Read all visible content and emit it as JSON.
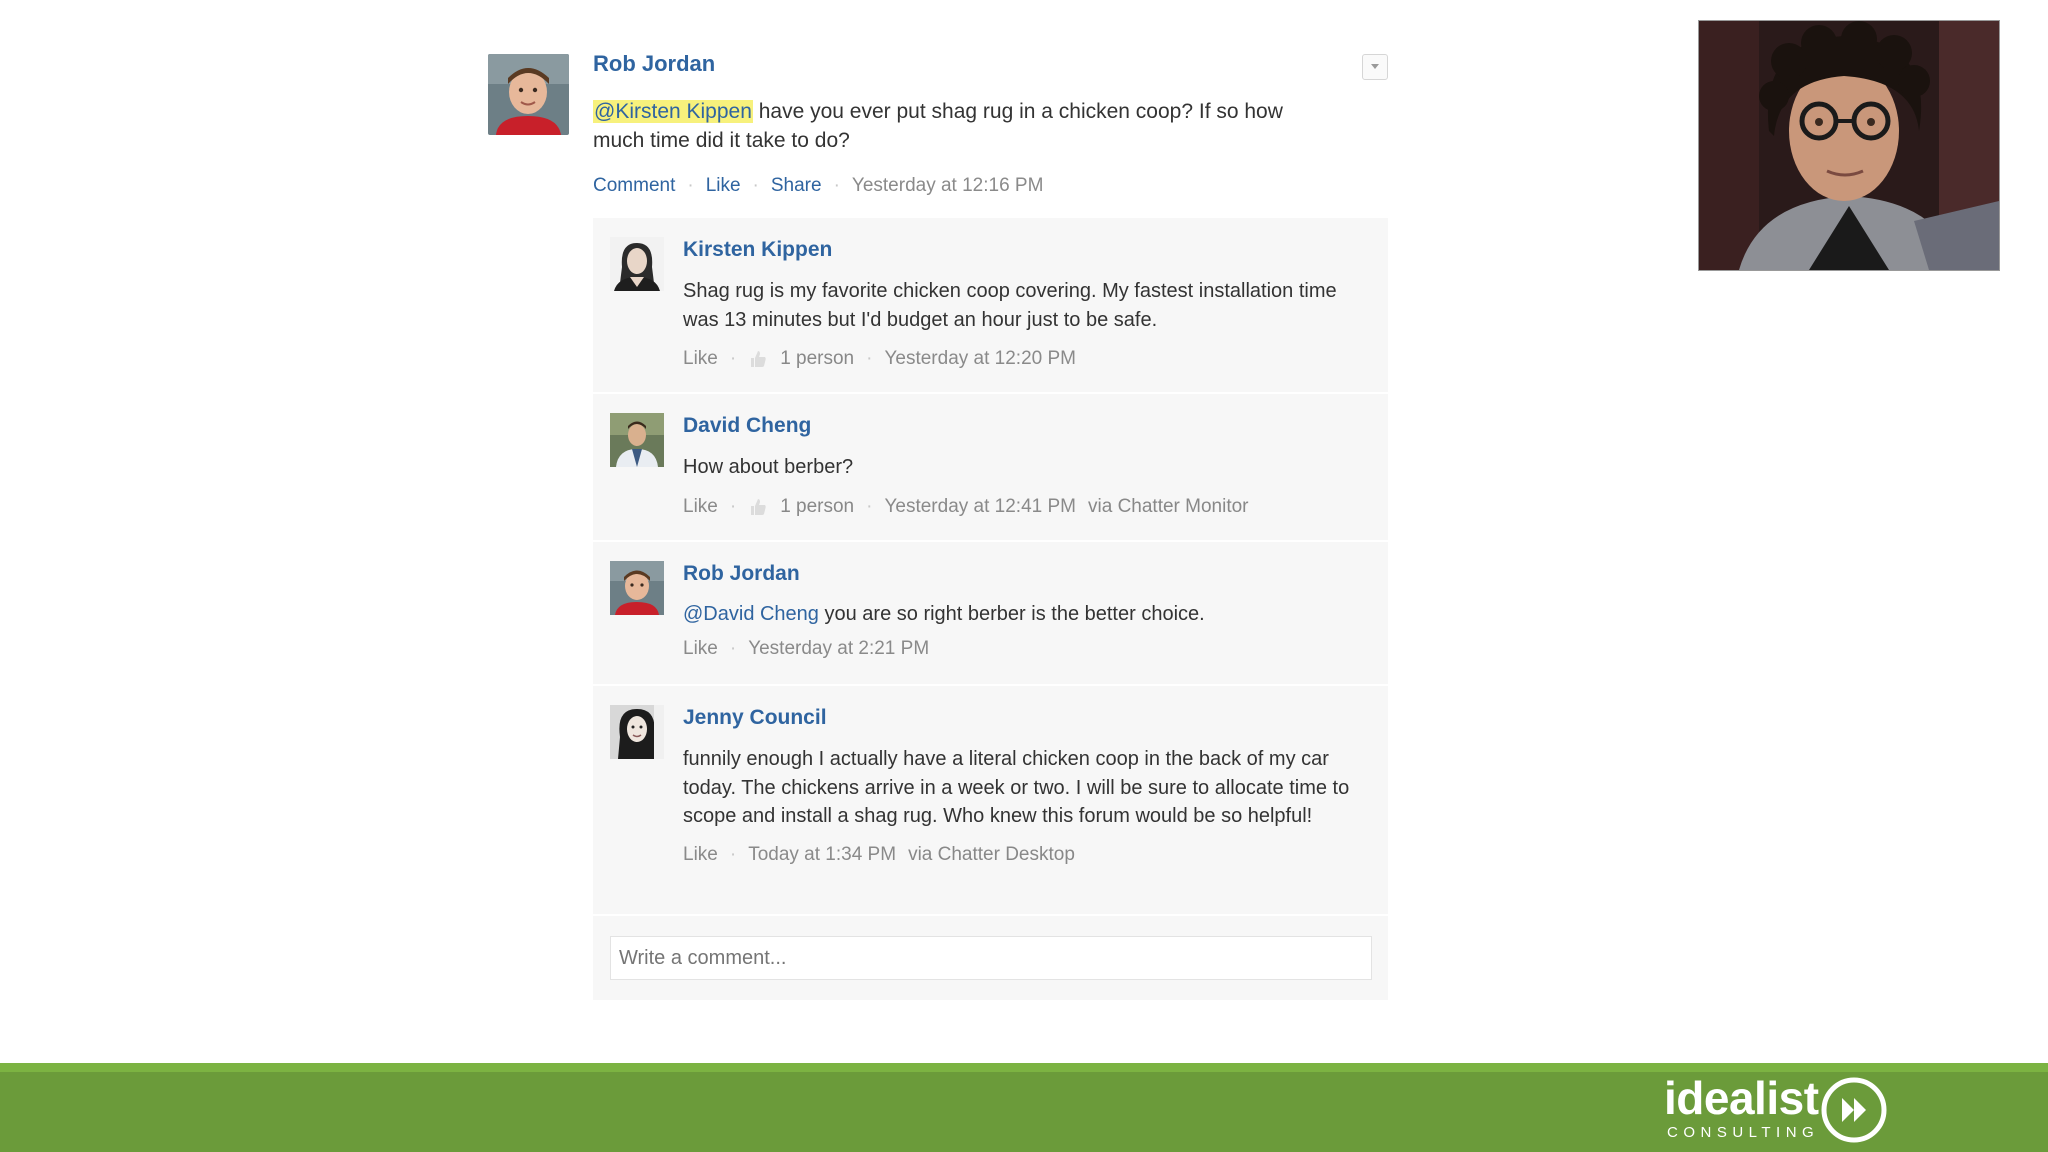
{
  "post": {
    "author": "Rob Jordan",
    "mention": "@Kirsten Kippen",
    "text": " have you ever put shag rug in a chicken coop? If so how much time did it take to do?",
    "actions": {
      "comment": "Comment",
      "like": "Like",
      "share": "Share"
    },
    "timestamp": "Yesterday at 12:16 PM"
  },
  "comments": [
    {
      "author": "Kirsten Kippen",
      "text": "Shag rug is my favorite chicken coop covering. My fastest installation time was 13 minutes but I'd budget an hour just to be safe.",
      "like": "Like",
      "likes": "1 person",
      "timestamp": "Yesterday at 12:20 PM"
    },
    {
      "author": "David Cheng",
      "text": "How about berber?",
      "like": "Like",
      "likes": "1 person",
      "timestamp": "Yesterday at 12:41 PM",
      "via": "via Chatter Monitor"
    },
    {
      "author": "Rob Jordan",
      "mention": "@David Cheng",
      "text": " you are so right berber is the better choice.",
      "like": "Like",
      "timestamp": "Yesterday at 2:21 PM"
    },
    {
      "author": "Jenny Council",
      "text": "funnily enough I actually have a literal chicken coop in the back of my car today. The chickens arrive in a week or two. I will be sure to allocate time to scope and install a shag rug. Who knew this forum would be so helpful!",
      "like": "Like",
      "timestamp": "Today at 1:34 PM",
      "via": "via Chatter Desktop"
    }
  ],
  "comment_input": {
    "placeholder": "Write a comment..."
  },
  "logo": {
    "word": "idealist",
    "sub": "CONSULTING"
  },
  "colors": {
    "link": "#2f64a0",
    "highlight": "#f7f17c",
    "footer": "#6b9b3a",
    "footer_line": "#7cb342"
  },
  "icons": [
    "dropdown-arrow-icon",
    "thumbs-up-icon",
    "play-forward-icon"
  ]
}
